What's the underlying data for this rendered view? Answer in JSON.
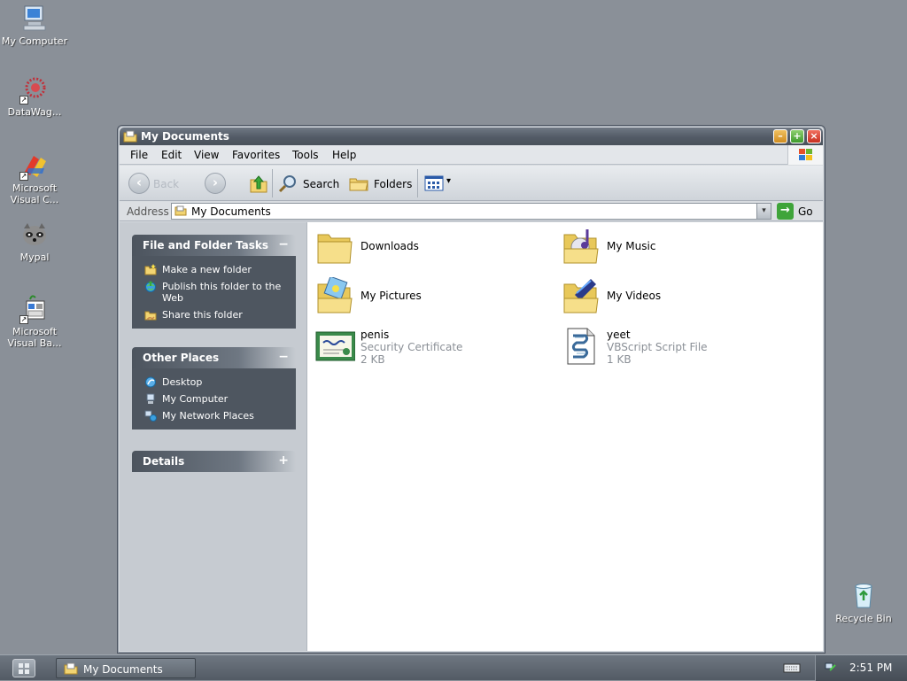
{
  "desktop": {
    "icons": [
      {
        "label": "My Computer"
      },
      {
        "label": "DataWag..."
      },
      {
        "label": "Microsoft Visual C..."
      },
      {
        "label": "Mypal"
      },
      {
        "label": "Microsoft Visual Ba..."
      },
      {
        "label": "Recycle Bin"
      }
    ]
  },
  "window": {
    "title": "My Documents",
    "controls": {
      "minimize": "–",
      "maximize": "+",
      "close": "×"
    },
    "menu": [
      "File",
      "Edit",
      "View",
      "Favorites",
      "Tools",
      "Help"
    ],
    "toolbar": {
      "back_label": "Back",
      "back_glyph": "‹",
      "forward_glyph": "›",
      "search_label": "Search",
      "folders_label": "Folders",
      "views_arrow": "▾"
    },
    "address": {
      "label": "Address",
      "value": "My Documents",
      "dropdown_glyph": "▾",
      "go_label": "Go",
      "go_glyph": "→"
    }
  },
  "taskpane": {
    "groups": [
      {
        "title": "File and Folder Tasks",
        "toggle": "−",
        "items": [
          "Make a new folder",
          "Publish this folder to the Web",
          "Share this folder"
        ]
      },
      {
        "title": "Other Places",
        "toggle": "−",
        "items": [
          "Desktop",
          "My Computer",
          "My Network Places"
        ]
      },
      {
        "title": "Details",
        "toggle": "+",
        "items": []
      }
    ]
  },
  "content": {
    "items": [
      {
        "name": "Downloads",
        "icon": "folder-icon"
      },
      {
        "name": "My Music",
        "icon": "music-folder-icon"
      },
      {
        "name": "My Pictures",
        "icon": "pictures-folder-icon"
      },
      {
        "name": "My Videos",
        "icon": "videos-folder-icon"
      },
      {
        "name": "penis",
        "type": "Security Certificate",
        "size": "2 KB",
        "icon": "certificate-icon"
      },
      {
        "name": "yeet",
        "type": "VBScript Script File",
        "size": "1 KB",
        "icon": "script-icon"
      }
    ]
  },
  "taskbar": {
    "window_button": "My Documents",
    "clock": "2:51 PM"
  },
  "colors": {
    "desktop": "#8a9098",
    "titlebar": "#535b66",
    "taskpane_group": "#4e5660",
    "go_green": "#3fa43a"
  }
}
